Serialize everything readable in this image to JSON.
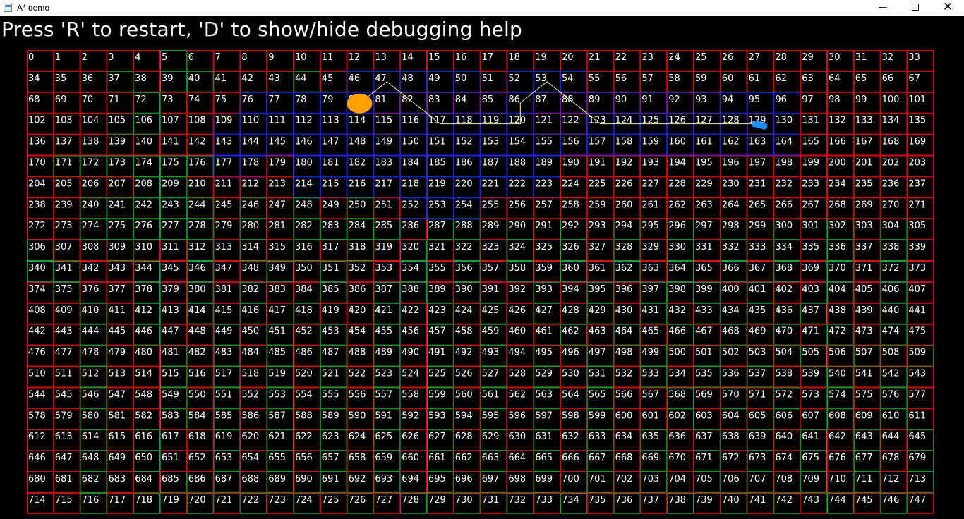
{
  "window": {
    "title": "A* demo",
    "minimize_glyph": "—",
    "close_glyph": "✕"
  },
  "instructions": "Press 'R' to restart, 'D' to show/hide debugging help",
  "grid": {
    "columns": 34,
    "rows": 22,
    "first_cell": 0,
    "last_cell": 747,
    "open_cells": [
      46,
      47,
      48,
      49,
      50,
      52,
      53,
      54,
      76,
      77,
      78,
      79,
      80,
      86,
      94,
      95,
      96,
      109,
      110,
      111,
      112,
      113,
      114,
      116,
      117,
      118,
      119,
      120,
      123,
      124,
      125,
      126,
      127,
      128,
      130,
      143,
      144,
      145,
      146,
      147,
      148,
      149,
      150,
      151,
      152,
      153,
      154,
      155,
      156,
      157,
      158,
      159,
      160,
      161,
      162,
      163,
      164,
      177,
      178,
      180,
      181,
      182,
      183,
      184,
      185,
      186,
      187,
      188,
      189,
      214,
      215,
      216,
      217,
      218,
      219,
      220,
      221,
      222,
      223,
      252,
      253,
      254
    ],
    "closed_cells": [
      81,
      82,
      83,
      84,
      85,
      87,
      88,
      89,
      90,
      91,
      92,
      93,
      115,
      121,
      122,
      129
    ],
    "green_cells": [
      5,
      37,
      40,
      39,
      44,
      72,
      105,
      106,
      171,
      172,
      173,
      174,
      175,
      176,
      208,
      209,
      240,
      241,
      242,
      243,
      244,
      246,
      248,
      250,
      274,
      275,
      276,
      277,
      278,
      280,
      282,
      283,
      284,
      285,
      287,
      288,
      290,
      292,
      294,
      296,
      298,
      300,
      302,
      304,
      306,
      309,
      312,
      314,
      316,
      318,
      320,
      322,
      324,
      326,
      328,
      330,
      332,
      334,
      336,
      338,
      340,
      341,
      344,
      346,
      349,
      351,
      354,
      356,
      358,
      360,
      362,
      364,
      366,
      368,
      370,
      372,
      375,
      378,
      380,
      382,
      385,
      387,
      388,
      390,
      393,
      395,
      397,
      398,
      399,
      401,
      404,
      406,
      410,
      412,
      414,
      416,
      418,
      421,
      423,
      425,
      427,
      429,
      431,
      433,
      435,
      437,
      440,
      444,
      446,
      449,
      451,
      453,
      455,
      457,
      459,
      462,
      464,
      466,
      468,
      470,
      472,
      474,
      478,
      481,
      483,
      485,
      487,
      489,
      491,
      493,
      495,
      497,
      499,
      501,
      503,
      505,
      507,
      509,
      512,
      515,
      517,
      519,
      521,
      523,
      525,
      527,
      529,
      531,
      533,
      535,
      537,
      540,
      542,
      546,
      549,
      551,
      553,
      555,
      557,
      559,
      561,
      563,
      565,
      568,
      570,
      572,
      574,
      576,
      580,
      583,
      585,
      587,
      589,
      591,
      593,
      595,
      597,
      599,
      602,
      604,
      606,
      608,
      610,
      614,
      616,
      619,
      621,
      623,
      625,
      627,
      629,
      631,
      633,
      635,
      637,
      639,
      641,
      643,
      645,
      648,
      650,
      653,
      655,
      657,
      659,
      661,
      663,
      665,
      667,
      669,
      671,
      673,
      675,
      677,
      679,
      682,
      685,
      687,
      689,
      691,
      693,
      695,
      697,
      699,
      701,
      703,
      705,
      707,
      709,
      711,
      713,
      716,
      718,
      720,
      722,
      724,
      726,
      728,
      730,
      732,
      734,
      736,
      738,
      740,
      742,
      744,
      746
    ],
    "agent": {
      "cell": 80,
      "color": "#ff9f00"
    },
    "target": {
      "cell": 129,
      "color": "#1e90ff"
    },
    "path_cells": [
      80,
      47,
      117,
      118,
      119,
      120,
      86,
      53,
      123,
      124,
      125,
      126,
      127,
      128,
      129
    ],
    "colors": {
      "default_border": "#d11010",
      "open_border": "#1a2bd6",
      "closed_border": "#7a1f9e",
      "green_border": "#1e9a3a",
      "path_line": "#f2f28a",
      "label": "#ffffff"
    }
  }
}
